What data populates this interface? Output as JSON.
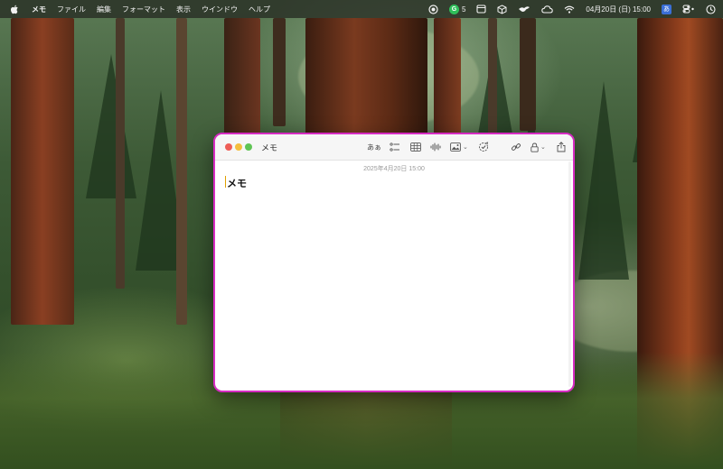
{
  "menubar": {
    "app_name": "メモ",
    "items": [
      "ファイル",
      "編集",
      "フォーマット",
      "表示",
      "ウインドウ",
      "ヘルプ"
    ],
    "grammarly_count": "5",
    "ime_label": "あ",
    "clock": "04月20日 (日) 15:00"
  },
  "window": {
    "title": "メモ",
    "format_label": "あぁ",
    "border_color": "#d62bc2"
  },
  "note": {
    "date": "2025年4月20日 15:00",
    "title": "メモ"
  },
  "icons": [
    "apple-icon",
    "record-icon",
    "grammarly-icon",
    "window-icon",
    "cube-icon",
    "bird-icon",
    "cloud-icon",
    "wifi-icon",
    "input-method-icon",
    "control-center-icon",
    "clock-icon",
    "checklist-icon",
    "table-icon",
    "audio-icon",
    "media-icon",
    "collaborate-icon",
    "link-icon",
    "lock-icon",
    "share-icon"
  ]
}
